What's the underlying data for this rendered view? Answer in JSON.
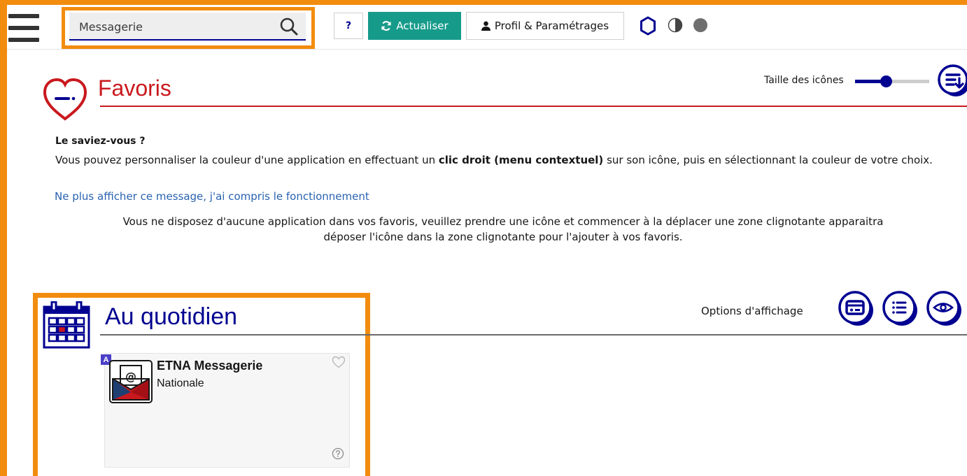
{
  "search": {
    "placeholder": "Messagerie"
  },
  "toolbar": {
    "help_label": "?",
    "refresh_label": "Actualiser",
    "profile_label": "Profil & Paramétrages"
  },
  "favoris": {
    "title": "Favoris",
    "icon_size_label": "Taille des icônes",
    "icon_size_value": 0.4,
    "tip_title": "Le saviez-vous ?",
    "tip_text_1": "Vous pouvez personnaliser la couleur d'une application en effectuant un ",
    "tip_text_bold": "clic droit (menu contextuel)",
    "tip_text_2": " sur son icône, puis en sélectionnant la couleur de votre choix.",
    "dismiss_link": "Ne plus afficher ce message, j'ai compris le fonctionnement",
    "empty_line_1": "Vous ne disposez d'aucune application dans vos favoris, veuillez prendre une icône et commencer à la déplacer une zone clignotante apparaitra",
    "empty_line_2": "déposer l'icône dans la zone clignotante pour l'ajouter à vos favoris."
  },
  "section": {
    "title": "Au quotidien",
    "display_options_label": "Options d'affichage"
  },
  "apps": [
    {
      "badge": "A",
      "name": "ETNA Messagerie",
      "scope": "Nationale"
    }
  ],
  "colors": {
    "accent_blue": "#000091",
    "favoris_red": "#c9191e",
    "refresh_green": "#169b8a",
    "highlight_orange": "#f28c0f"
  }
}
